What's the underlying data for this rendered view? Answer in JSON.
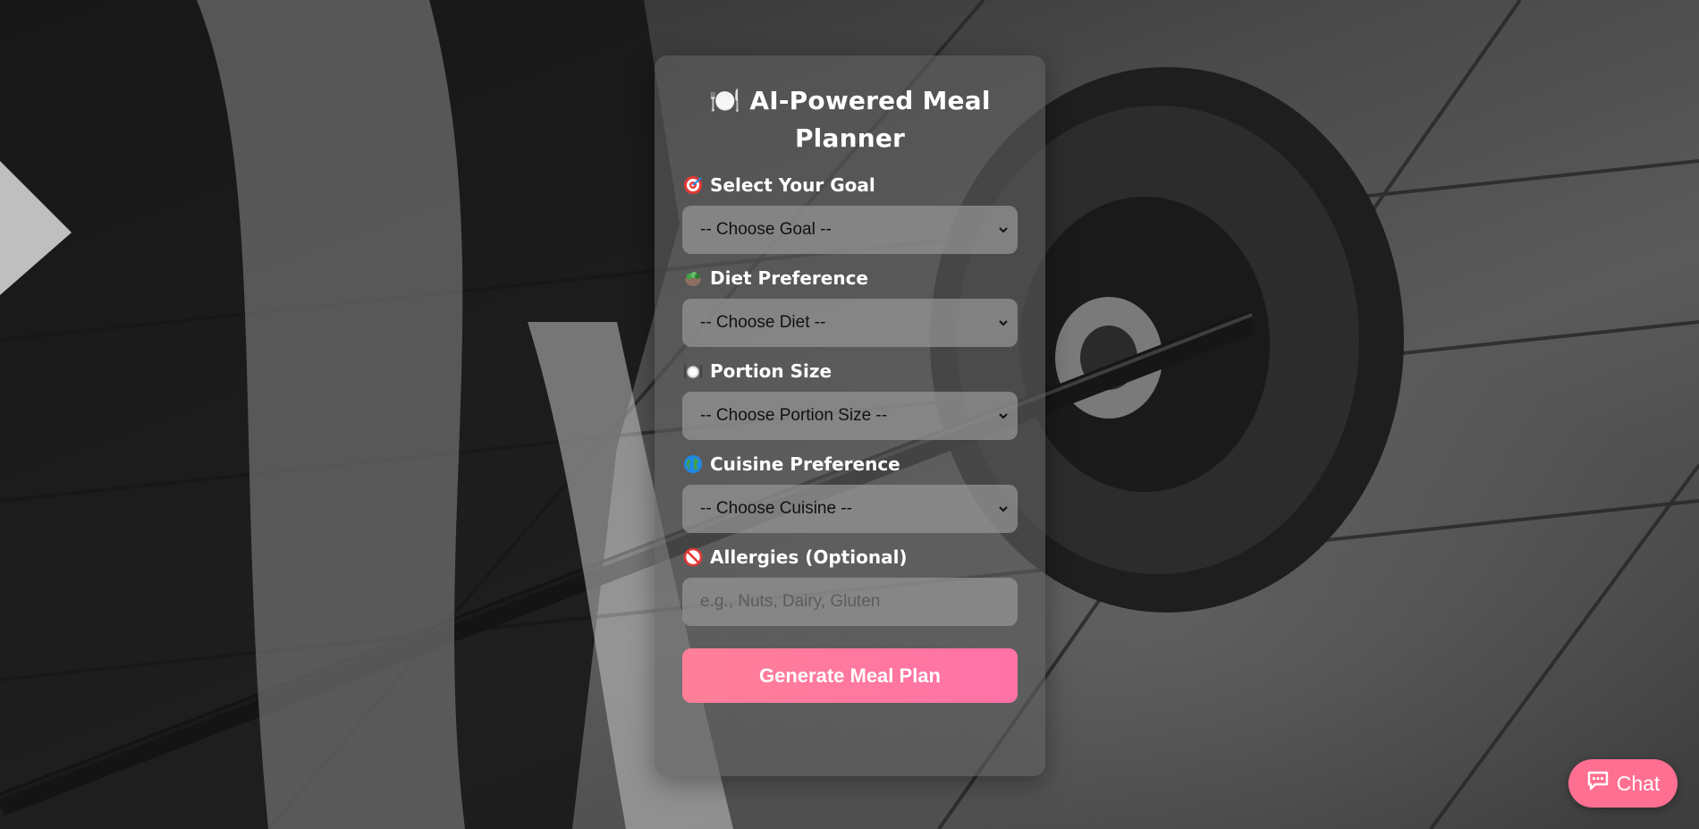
{
  "form": {
    "title": "🍽️ AI-Powered Meal Planner",
    "goal": {
      "label": "Select Your Goal",
      "icon": "target-icon",
      "selected": "-- Choose Goal --"
    },
    "diet": {
      "label": "Diet Preference",
      "icon": "salad-icon",
      "selected": "-- Choose Diet --"
    },
    "portion": {
      "label": "Portion Size",
      "icon": "plate-cutlery-icon",
      "selected": "-- Choose Portion Size --"
    },
    "cuisine": {
      "label": "Cuisine Preference",
      "icon": "globe-icon",
      "selected": "-- Choose Cuisine --"
    },
    "allergies": {
      "label": "Allergies (Optional)",
      "icon": "prohibited-icon",
      "placeholder": "e.g., Nuts, Dairy, Gluten",
      "value": ""
    },
    "submit_label": "Generate Meal Plan"
  },
  "chat": {
    "label": "Chat",
    "icon": "chat-bubble-icon"
  },
  "colors": {
    "accent": "#ff7098",
    "card_bg": "#5f5f5f",
    "field_bg": "#969696",
    "text": "#ffffff"
  }
}
